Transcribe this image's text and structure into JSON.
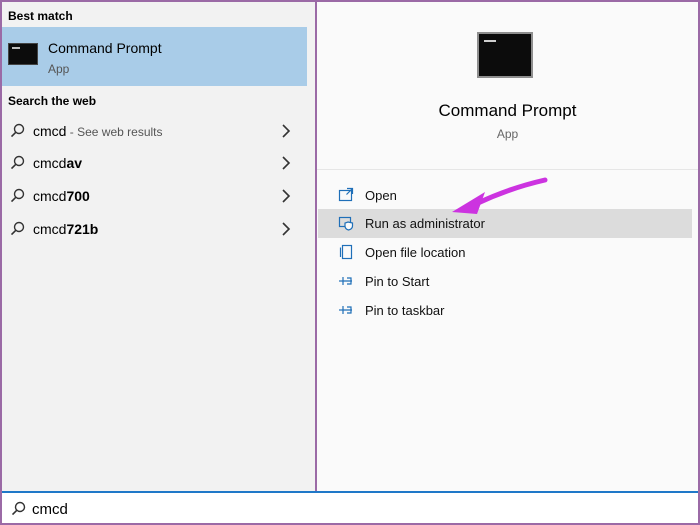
{
  "left": {
    "best_match_header": "Best match",
    "best_match": {
      "title": "Command Prompt",
      "subtitle": "App",
      "icon": "command-prompt-icon"
    },
    "web_header": "Search the web",
    "web_results": [
      {
        "prefix": "cmcd",
        "bold": "",
        "suffix": " - See web results"
      },
      {
        "prefix": "cmcd",
        "bold": "av",
        "suffix": ""
      },
      {
        "prefix": "cmcd",
        "bold": "700",
        "suffix": ""
      },
      {
        "prefix": "cmcd",
        "bold": "721b",
        "suffix": ""
      }
    ]
  },
  "right": {
    "app_title": "Command Prompt",
    "app_subtitle": "App",
    "actions": [
      {
        "label": "Open",
        "icon": "open-icon"
      },
      {
        "label": "Run as administrator",
        "icon": "shield-icon"
      },
      {
        "label": "Open file location",
        "icon": "file-location-icon"
      },
      {
        "label": "Pin to Start",
        "icon": "pin-icon"
      },
      {
        "label": "Pin to taskbar",
        "icon": "pin-icon"
      }
    ]
  },
  "search": {
    "value": "cmcd"
  },
  "colors": {
    "frame": "#9b6aa6",
    "selected": "#a9cce8",
    "highlight": "#dcdcdc",
    "accent": "#1f78c8",
    "arrow": "#cc33e0"
  }
}
